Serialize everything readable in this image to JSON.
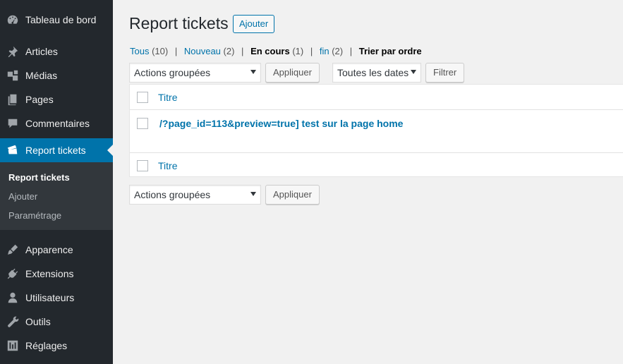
{
  "sidebar": {
    "items": [
      {
        "label": "Tableau de bord",
        "icon": "dashboard-icon"
      },
      {
        "label": "Articles",
        "icon": "pin-icon"
      },
      {
        "label": "Médias",
        "icon": "media-icon"
      },
      {
        "label": "Pages",
        "icon": "pages-icon"
      },
      {
        "label": "Commentaires",
        "icon": "comments-icon"
      },
      {
        "label": "Report tickets",
        "icon": "tickets-icon"
      },
      {
        "label": "Apparence",
        "icon": "appearance-icon"
      },
      {
        "label": "Extensions",
        "icon": "plugin-icon"
      },
      {
        "label": "Utilisateurs",
        "icon": "user-icon"
      },
      {
        "label": "Outils",
        "icon": "wrench-icon"
      },
      {
        "label": "Réglages",
        "icon": "settings-icon"
      }
    ],
    "submenu": [
      {
        "label": "Report tickets"
      },
      {
        "label": "Ajouter"
      },
      {
        "label": "Paramétrage"
      }
    ],
    "colors": {
      "bg": "#23282d",
      "active": "#0073aa",
      "submenu_bg": "#32373c"
    }
  },
  "header": {
    "title": "Report tickets",
    "add_label": "Ajouter"
  },
  "filters": {
    "views": [
      {
        "label": "Tous",
        "count": "(10)"
      },
      {
        "label": "Nouveau",
        "count": "(2)"
      },
      {
        "label": "En cours",
        "count": "(1)"
      },
      {
        "label": "fin",
        "count": "(2)"
      }
    ],
    "sort_label": "Trier par ordre"
  },
  "bulk": {
    "select_value": "Actions groupées",
    "apply_label": "Appliquer",
    "dates_value": "Toutes les dates",
    "filter_label": "Filtrer"
  },
  "table": {
    "column_header": "Titre",
    "rows": [
      {
        "title": "/?page_id=113&preview=true] test sur la page home"
      }
    ]
  }
}
